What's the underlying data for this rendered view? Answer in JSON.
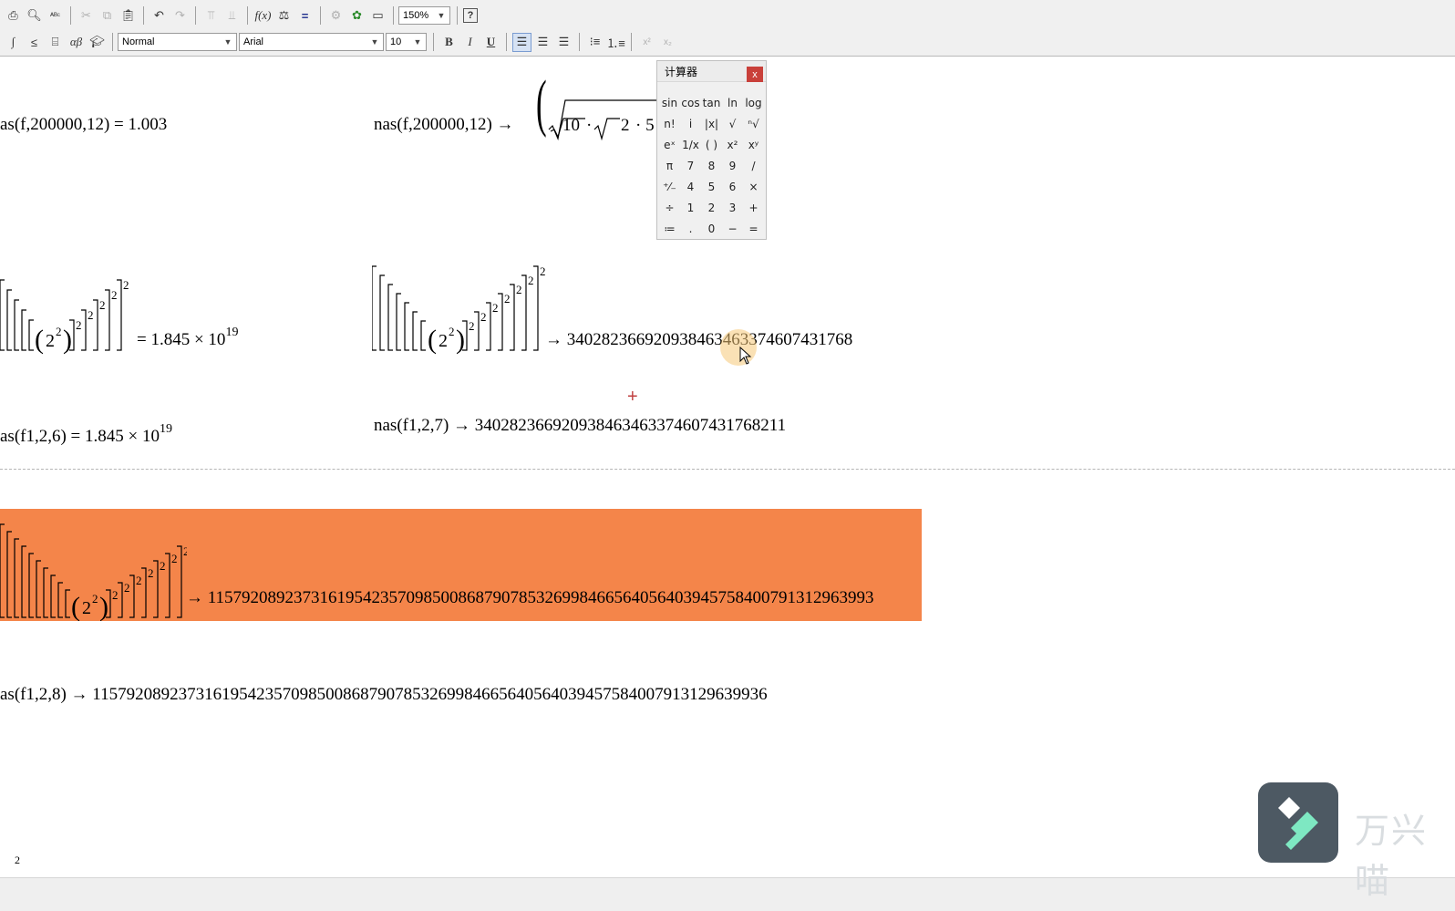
{
  "toolbar": {
    "row1": {
      "buttons": [
        "print-icon",
        "print-preview-icon",
        "spell-check-icon",
        "cut-icon",
        "copy-icon",
        "paste-icon",
        "undo-icon",
        "redo-icon",
        "align-top-icon",
        "align-bottom-icon",
        "insert-function-icon",
        "insert-unit-icon",
        "calculate-icon",
        "component-icon",
        "resource-icon",
        "toggle-region-icon"
      ],
      "zoom_value": "150%",
      "help_label": "?"
    },
    "row2": {
      "style_value": "Normal",
      "font_value": "Arial",
      "size_value": "10",
      "bold_label": "B",
      "italic_label": "I",
      "underline_label": "U"
    }
  },
  "calculator": {
    "title": "计算器",
    "close_label": "x",
    "keys": [
      "sin",
      "cos",
      "tan",
      "ln",
      "log",
      "n!",
      "i",
      "|x|",
      "√",
      "ⁿ√",
      "eˣ",
      "1/x",
      "( )",
      "x²",
      "xʸ",
      "π",
      "7",
      "8",
      "9",
      "/",
      "⁺⁄₋",
      "4",
      "5",
      "6",
      "×",
      "÷",
      "1",
      "2",
      "3",
      "+",
      "≔",
      ".",
      "0",
      "−",
      "="
    ]
  },
  "worksheet": {
    "eq1_left": "as(f,200000,12) = 1.003",
    "eq1_right_prefix": "nas(f,200000,12) →",
    "eq1_right_sqrt1": "10",
    "eq1_right_sqrt2": "2",
    "eq1_right_tail": "· 5",
    "dot": "·",
    "tower_left_result_mantissa": "= 1.845 × 10",
    "tower_left_result_exp": "19",
    "tower_right_result": "→ 340282366920938463463374607431768",
    "eq3_left_mantissa": "as(f1,2,6) = 1.845 × 10",
    "eq3_left_exp": "19",
    "eq3_right": "nas(f1,2,7) → 340282366920938463463374607431768211",
    "tower_big_result": "→ 11579208923731619542357098500868790785326998466564056403945758400791312963993",
    "eq5": "as(f1,2,8) → 115792089237316195423570985008687907853269984665640564039457584007913129639936",
    "base": "2",
    "exp": "2",
    "bottom_fragment": "2"
  },
  "watermark": {
    "text": "万兴喵"
  },
  "colors": {
    "highlight": "#f4854a",
    "toolbar_bg": "#f0f0f0",
    "close_red": "#c9403a"
  }
}
